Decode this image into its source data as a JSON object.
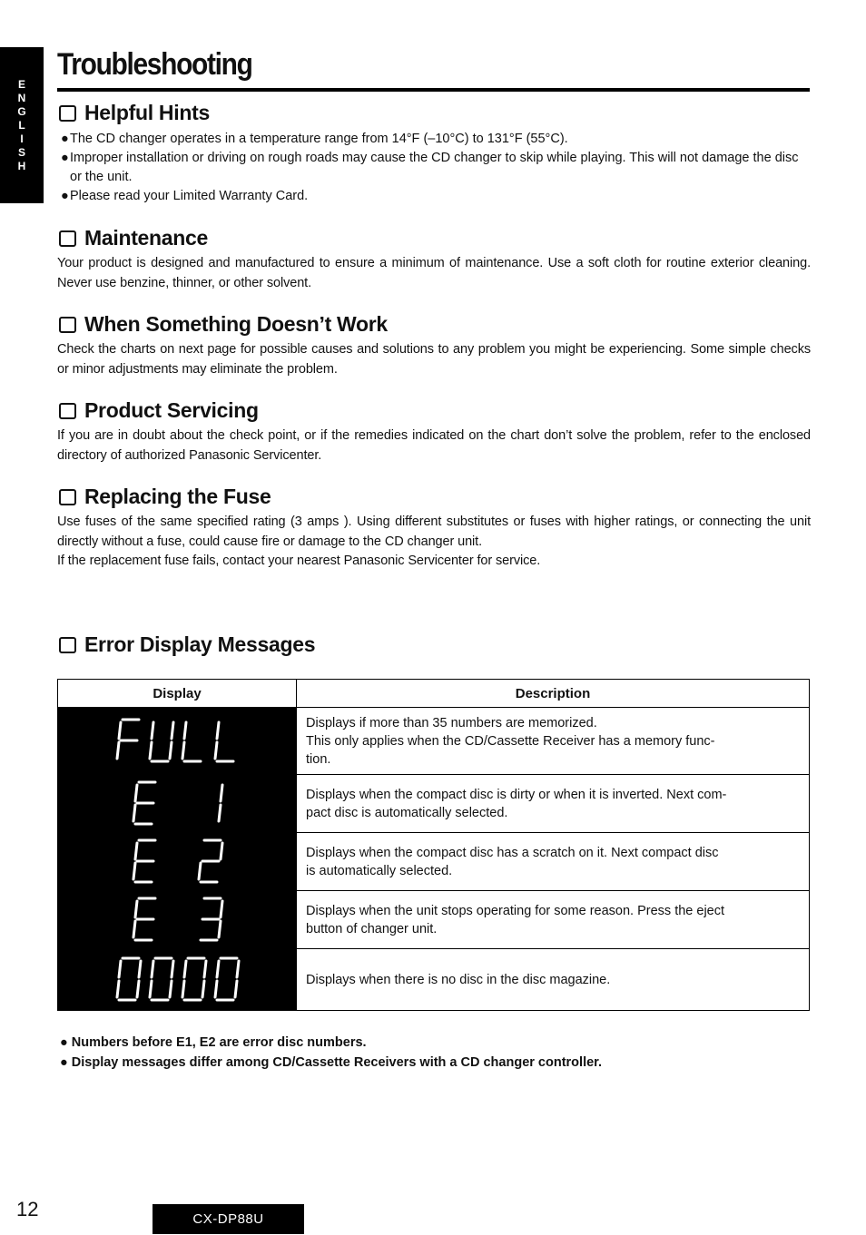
{
  "language_tab": [
    "E",
    "N",
    "G",
    "L",
    "I",
    "S",
    "H"
  ],
  "page_title": "Troubleshooting",
  "sections": {
    "helpful_hints": {
      "heading": "Helpful Hints",
      "bullets": [
        "The CD changer operates in a temperature range from 14°F (–10°C) to 131°F (55°C).",
        "Improper installation or driving on rough roads may cause the CD changer to skip while playing. This will not damage the disc or the unit.",
        "Please read your Limited Warranty Card."
      ]
    },
    "maintenance": {
      "heading": "Maintenance",
      "text": "Your product is designed and manufactured to ensure a minimum of maintenance. Use a soft cloth for routine exterior cleaning. Never use benzine, thinner, or other solvent."
    },
    "when_something": {
      "heading": "When Something Doesn’t Work",
      "text": "Check the charts on next page for possible causes and solutions to any problem you might be experiencing. Some simple checks or minor adjustments may eliminate the problem."
    },
    "product_servicing": {
      "heading": "Product Servicing",
      "text": "If you are in doubt about the check point, or if the remedies indicated on the chart don’t solve the problem, refer to the enclosed directory of authorized Panasonic Servicenter."
    },
    "replacing_fuse": {
      "heading": "Replacing the Fuse",
      "lines": [
        "Use fuses of the same specified rating (3 amps ). Using different substitutes or fuses with higher ratings, or connecting the unit directly without a fuse, could cause fire or damage to the CD changer unit.",
        "If the replacement fuse fails, contact your nearest Panasonic Servicenter for service."
      ]
    },
    "error_messages": {
      "heading": "Error Display Messages",
      "columns": [
        "Display",
        "Description"
      ],
      "rows": [
        {
          "display": "FULL",
          "description": "Displays if more than 35 numbers are memorized.\nThis only applies when the CD/Cassette Receiver has a memory func-\ntion."
        },
        {
          "display": "E 1",
          "description": "Displays when the compact disc is dirty or when it is inverted. Next com-\npact disc is automatically selected."
        },
        {
          "display": "E 2",
          "description": "Displays when the compact disc has a scratch on it. Next compact disc\nis automatically selected."
        },
        {
          "display": "E 3",
          "description": "Displays when the unit stops operating for some reason. Press the eject\nbutton of changer unit."
        },
        {
          "display": "0000",
          "description": "Displays when there is no disc in the disc magazine."
        }
      ],
      "notes": [
        "Numbers before E1, E2 are error disc numbers.",
        "Display messages differ among CD/Cassette Receivers with a CD changer controller."
      ]
    }
  },
  "footer": {
    "page_number": "12",
    "model": "CX-DP88U"
  }
}
